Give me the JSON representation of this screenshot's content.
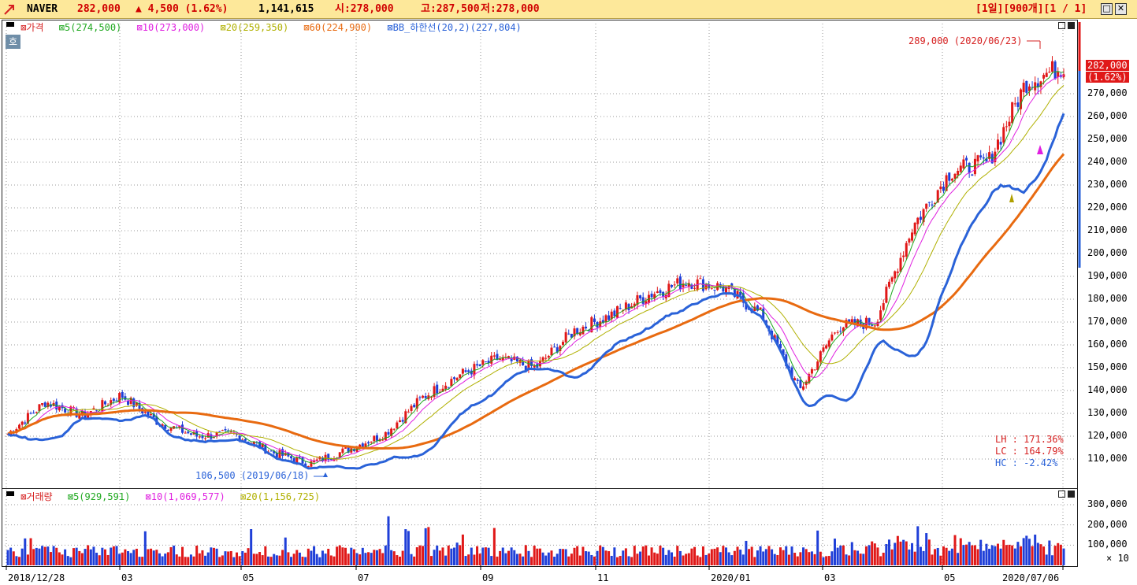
{
  "header": {
    "symbol": "NAVER",
    "price": "282,000",
    "change": "▲ 4,500 (1.62%)",
    "volume": "1,141,615",
    "open": "시:278,000",
    "high": "고:287,500",
    "low": "저:278,000",
    "period": "[1일][900개][1 / 1]"
  },
  "price_panel": {
    "legend": [
      {
        "label": "가격",
        "color": "#d62020"
      },
      {
        "label": "5(274,500)",
        "color": "#1fa81f"
      },
      {
        "label": "10(273,000)",
        "color": "#e020e0"
      },
      {
        "label": "20(259,350)",
        "color": "#b0b000"
      },
      {
        "label": "60(224,900)",
        "color": "#e86a10"
      },
      {
        "label": "BB_하한선(20,2)(227,804)",
        "color": "#2a62d8"
      }
    ],
    "ho_button": "호",
    "high_note": "289,000 (2020/06/23)",
    "low_note": "106,500 (2019/06/18)",
    "stats": [
      "LH :  171.36%",
      "LC :  164.79%",
      "HC :   -2.42%"
    ],
    "current_price": "282,000",
    "current_change": "(1.62%)"
  },
  "volume_panel": {
    "legend": [
      {
        "label": "거래량",
        "color": "#d62020"
      },
      {
        "label": "5(929,591)",
        "color": "#1fa81f"
      },
      {
        "label": "10(1,069,577)",
        "color": "#e020e0"
      },
      {
        "label": "20(1,156,725)",
        "color": "#b0b000"
      }
    ],
    "multiplier": "× 10"
  },
  "x_axis": [
    "2018/12/28",
    "03",
    "05",
    "07",
    "09",
    "11",
    "2020/01",
    "03",
    "05",
    "2020/07/06"
  ],
  "chart_data": {
    "type": "line",
    "y_axis_ticks": [
      110000,
      120000,
      130000,
      140000,
      150000,
      160000,
      170000,
      180000,
      190000,
      200000,
      210000,
      220000,
      230000,
      240000,
      250000,
      260000,
      270000
    ],
    "volume_axis_ticks": [
      100000,
      200000,
      300000
    ],
    "x_ticks": [
      "2018/12/28",
      "03",
      "05",
      "07",
      "09",
      "11",
      "2020/01",
      "03",
      "05",
      "2020/07/06"
    ],
    "price_close_approx": [
      [
        "2018/12/28",
        121000
      ],
      [
        "2019/01",
        135000
      ],
      [
        "2019/02",
        129000
      ],
      [
        "2019/02/20",
        138000
      ],
      [
        "2019/03",
        126000
      ],
      [
        "2019/04",
        120000
      ],
      [
        "2019/05",
        121000
      ],
      [
        "2019/05/20",
        113000
      ],
      [
        "2019/06/18",
        108000
      ],
      [
        "2019/07",
        114000
      ],
      [
        "2019/07/25",
        121000
      ],
      [
        "2019/08",
        137000
      ],
      [
        "2019/09",
        147000
      ],
      [
        "2019/09/20",
        154000
      ],
      [
        "2019/10",
        150000
      ],
      [
        "2019/11",
        166000
      ],
      [
        "2019/11/20",
        173000
      ],
      [
        "2019/12",
        182000
      ],
      [
        "2020/01",
        188000
      ],
      [
        "2020/02",
        185000
      ],
      [
        "2020/02/20",
        173000
      ],
      [
        "2020/03/19",
        140000
      ],
      [
        "2020/04",
        168000
      ],
      [
        "2020/04/20",
        170000
      ],
      [
        "2020/05",
        212000
      ],
      [
        "2020/05/20",
        236000
      ],
      [
        "2020/06",
        240000
      ],
      [
        "2020/06/23",
        275000
      ],
      [
        "2020/07/06",
        282000
      ]
    ],
    "series": [
      {
        "name": "5",
        "last": 274500
      },
      {
        "name": "10",
        "last": 273000
      },
      {
        "name": "20",
        "last": 259350
      },
      {
        "name": "60",
        "last": 224900
      },
      {
        "name": "BB_하한선(20,2)",
        "last": 227804
      }
    ],
    "highest": {
      "value": 289000,
      "date": "2020/06/23"
    },
    "lowest": {
      "value": 106500,
      "date": "2019/06/18"
    }
  }
}
